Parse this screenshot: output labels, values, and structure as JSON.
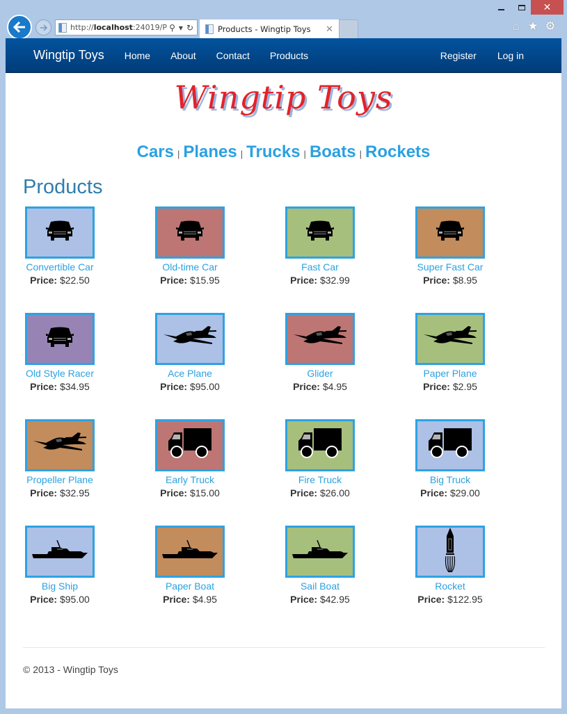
{
  "browser": {
    "url_prefix": "http://",
    "url_host": "localhost",
    "url_rest": ":24019/P",
    "tab_title": "Products - Wingtip Toys",
    "close_glyph": "✕",
    "min_label": "",
    "home_icon": "⌂",
    "star_icon": "★",
    "gear_icon": "⚙"
  },
  "navbar": {
    "brand": "Wingtip Toys",
    "links": [
      "Home",
      "About",
      "Contact",
      "Products"
    ],
    "right_links": [
      "Register",
      "Log in"
    ]
  },
  "logo": "Wingtip Toys",
  "categories": [
    "Cars",
    "Planes",
    "Trucks",
    "Boats",
    "Rockets"
  ],
  "category_separator": "|",
  "page_title": "Products",
  "price_label": "Price:",
  "products": [
    {
      "name": "Convertible Car",
      "price": "$22.50",
      "color": "#adc0e6",
      "icon": "car"
    },
    {
      "name": "Old-time Car",
      "price": "$15.95",
      "color": "#bd7673",
      "icon": "car"
    },
    {
      "name": "Fast Car",
      "price": "$32.99",
      "color": "#a7bf7d",
      "icon": "car"
    },
    {
      "name": "Super Fast Car",
      "price": "$8.95",
      "color": "#c28c5c",
      "icon": "car"
    },
    {
      "name": "Old Style Racer",
      "price": "$34.95",
      "color": "#9784b4",
      "icon": "car"
    },
    {
      "name": "Ace Plane",
      "price": "$95.00",
      "color": "#adc0e6",
      "icon": "plane"
    },
    {
      "name": "Glider",
      "price": "$4.95",
      "color": "#bd7673",
      "icon": "plane"
    },
    {
      "name": "Paper Plane",
      "price": "$2.95",
      "color": "#a7bf7d",
      "icon": "plane"
    },
    {
      "name": "Propeller Plane",
      "price": "$32.95",
      "color": "#c28c5c",
      "icon": "plane"
    },
    {
      "name": "Early Truck",
      "price": "$15.00",
      "color": "#bd7673",
      "icon": "truck"
    },
    {
      "name": "Fire Truck",
      "price": "$26.00",
      "color": "#a7bf7d",
      "icon": "truck"
    },
    {
      "name": "Big Truck",
      "price": "$29.00",
      "color": "#adc0e6",
      "icon": "truck"
    },
    {
      "name": "Big Ship",
      "price": "$95.00",
      "color": "#adc0e6",
      "icon": "boat"
    },
    {
      "name": "Paper Boat",
      "price": "$4.95",
      "color": "#c28c5c",
      "icon": "boat"
    },
    {
      "name": "Sail Boat",
      "price": "$42.95",
      "color": "#a7bf7d",
      "icon": "boat"
    },
    {
      "name": "Rocket",
      "price": "$122.95",
      "color": "#adc0e6",
      "icon": "rocket"
    }
  ],
  "footer": "© 2013 - Wingtip Toys"
}
